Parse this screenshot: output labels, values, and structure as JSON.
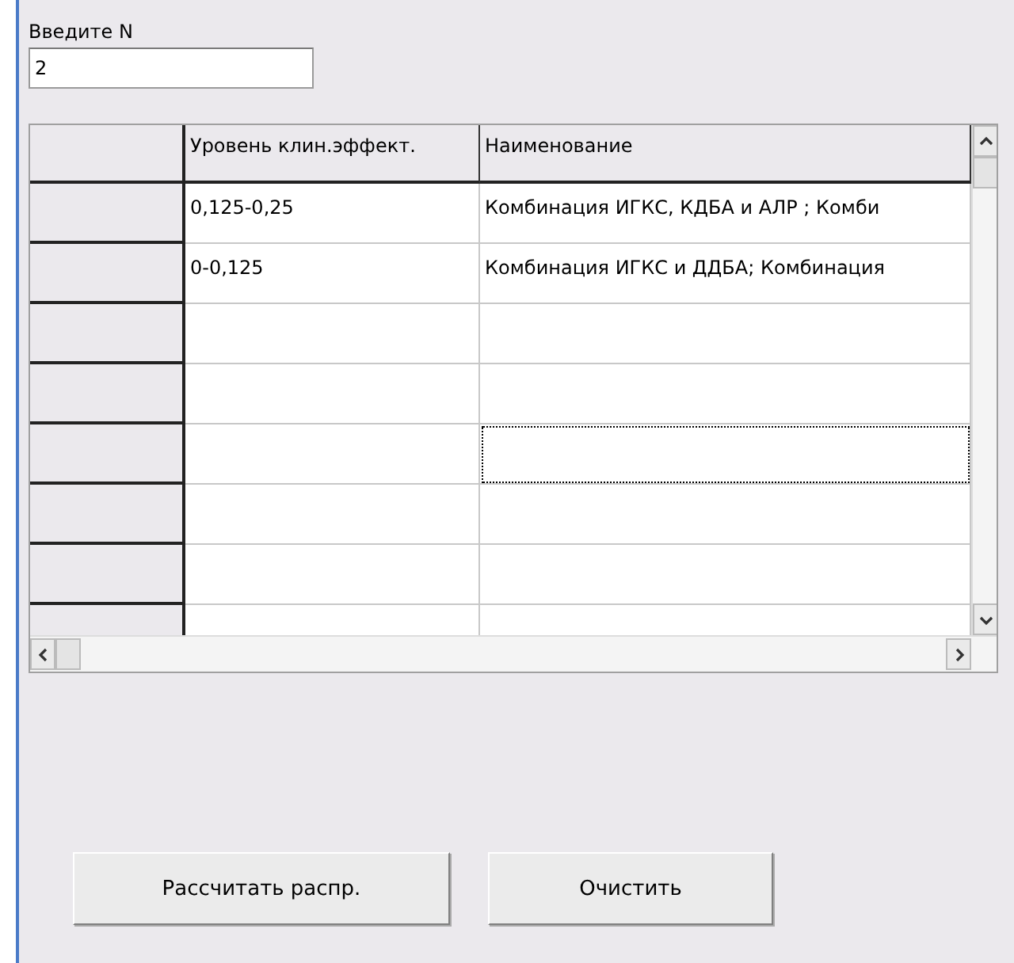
{
  "input": {
    "label": "Введите N",
    "value": "2"
  },
  "grid": {
    "columns": [
      "Уровень клин.эффект.",
      "Наименование"
    ],
    "rows": [
      {
        "level": "0,125-0,25",
        "name": "Комбинация ИГКС, КДБА и АЛР ; Комби",
        "focused": false
      },
      {
        "level": "0-0,125",
        "name": "Комбинация ИГКС и ДДБА; Комбинация",
        "focused": false
      },
      {
        "focused": false
      },
      {
        "focused": false
      },
      {
        "focused": true
      },
      {
        "focused": false
      },
      {
        "focused": false
      },
      {
        "focused": false
      }
    ]
  },
  "buttons": [
    "Рассчитать распр.",
    "Очистить"
  ]
}
